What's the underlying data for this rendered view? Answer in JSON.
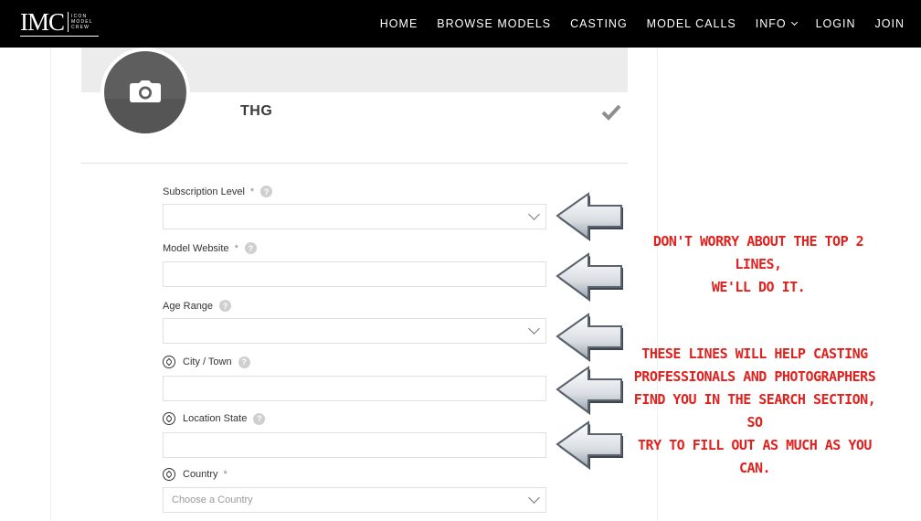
{
  "logo": {
    "mark": "IMC",
    "sub": [
      "ICON",
      "MODEL",
      "CREW"
    ]
  },
  "nav": {
    "items": [
      {
        "label": "HOME"
      },
      {
        "label": "BROWSE MODELS"
      },
      {
        "label": "CASTING"
      },
      {
        "label": "MODEL CALLS"
      },
      {
        "label": "INFO"
      },
      {
        "label": "LOGIN"
      },
      {
        "label": "JOIN"
      }
    ]
  },
  "profile": {
    "name": "THG",
    "verified_icon": "check-icon",
    "avatar_icon": "camera-icon"
  },
  "form": {
    "subscription_level": {
      "label": "Subscription Level",
      "required": "*",
      "help": "?",
      "value": ""
    },
    "model_website": {
      "label": "Model Website",
      "required": "*",
      "help": "?",
      "value": ""
    },
    "age_range": {
      "label": "Age Range",
      "help": "?",
      "value": ""
    },
    "city_town": {
      "label": "City / Town",
      "help": "?",
      "value": ""
    },
    "location_state": {
      "label": "Location State",
      "help": "?",
      "value": ""
    },
    "country": {
      "label": "Country",
      "required": "*",
      "placeholder": "Choose a Country"
    }
  },
  "annotations": {
    "top": [
      "Don't worry about the top 2 lines,",
      "we'll do it."
    ],
    "bottom": [
      "These lines will help casting",
      "professionals and photographers",
      "find you in the search section, so",
      "try to fill out as much as you can."
    ]
  },
  "colors": {
    "annotation": "#e0211d",
    "topbar": "#000000",
    "cover": "#ececec"
  }
}
